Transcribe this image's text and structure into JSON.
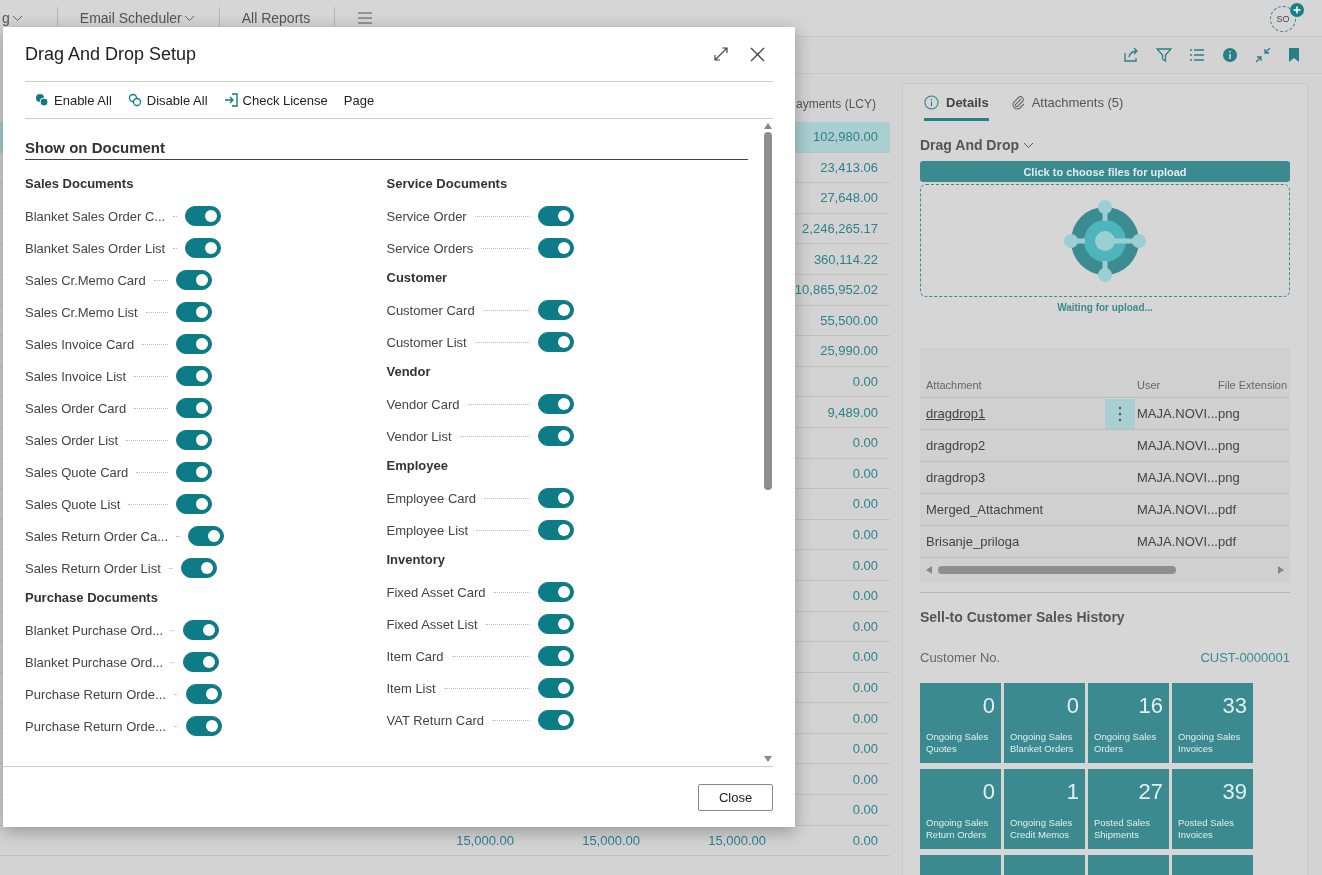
{
  "nav": {
    "items": [
      {
        "label": "g",
        "has_menu": true
      },
      {
        "label": "Email Scheduler",
        "has_menu": true
      },
      {
        "label": "All Reports",
        "has_menu": false
      }
    ]
  },
  "user": {
    "initials": "SO"
  },
  "list": {
    "column": "ayments (LCY)",
    "rows": [
      {
        "value": "102,980.00",
        "selected": true
      },
      {
        "value": "23,413.06",
        "selected": false
      },
      {
        "value": "27,648.00",
        "selected": false
      },
      {
        "value": "2,246,265.17",
        "selected": false
      },
      {
        "value": "360,114.22",
        "selected": false
      },
      {
        "value": "10,865,952.02",
        "selected": false
      },
      {
        "value": "55,500.00",
        "selected": false
      },
      {
        "value": "25,990.00",
        "selected": false
      },
      {
        "value": "0.00",
        "selected": false
      },
      {
        "value": "9,489.00",
        "selected": false
      },
      {
        "value": "0.00",
        "selected": false
      },
      {
        "value": "0.00",
        "selected": false
      },
      {
        "value": "0.00",
        "selected": false
      },
      {
        "value": "0.00",
        "selected": false
      },
      {
        "value": "0.00",
        "selected": false
      },
      {
        "value": "0.00",
        "selected": false
      },
      {
        "value": "0.00",
        "selected": false
      },
      {
        "value": "0.00",
        "selected": false
      },
      {
        "value": "0.00",
        "selected": false
      },
      {
        "value": "0.00",
        "selected": false
      },
      {
        "value": "0.00",
        "selected": false
      },
      {
        "value": "0.00",
        "selected": false
      },
      {
        "value": "0.00",
        "selected": false
      }
    ],
    "bottom_row": [
      "15,000.00",
      "15,000.00",
      "15,000.00",
      "0.00"
    ]
  },
  "dialog": {
    "title": "Drag And Drop Setup",
    "actions": [
      {
        "label": "Enable All",
        "kind": "enable"
      },
      {
        "label": "Disable All",
        "kind": "disable"
      },
      {
        "label": "Check License",
        "kind": "license"
      },
      {
        "label": "Page",
        "kind": "plain"
      }
    ],
    "section": "Show on Document",
    "columns": [
      [
        {
          "title": "Sales Documents",
          "items": [
            {
              "label": "Blanket Sales Order C...",
              "on": true
            },
            {
              "label": "Blanket Sales Order List",
              "on": true
            },
            {
              "label": "Sales Cr.Memo Card",
              "on": true
            },
            {
              "label": "Sales Cr.Memo List",
              "on": true
            },
            {
              "label": "Sales Invoice Card",
              "on": true
            },
            {
              "label": "Sales Invoice List",
              "on": true
            },
            {
              "label": "Sales Order Card",
              "on": true
            },
            {
              "label": "Sales Order List",
              "on": true
            },
            {
              "label": "Sales Quote Card",
              "on": true
            },
            {
              "label": "Sales Quote List",
              "on": true
            },
            {
              "label": "Sales Return Order Ca...",
              "on": true
            },
            {
              "label": "Sales Return Order List",
              "on": true
            }
          ]
        },
        {
          "title": "Purchase Documents",
          "items": [
            {
              "label": "Blanket Purchase Ord...",
              "on": true
            },
            {
              "label": "Blanket Purchase Ord...",
              "on": true
            },
            {
              "label": "Purchase Return Orde...",
              "on": true
            },
            {
              "label": "Purchase Return Orde...",
              "on": true
            }
          ]
        }
      ],
      [
        {
          "title": "Service Documents",
          "items": [
            {
              "label": "Service Order",
              "on": true
            },
            {
              "label": "Service Orders",
              "on": true
            }
          ]
        },
        {
          "title": "Customer",
          "items": [
            {
              "label": "Customer Card",
              "on": true
            },
            {
              "label": "Customer List",
              "on": true
            }
          ]
        },
        {
          "title": "Vendor",
          "items": [
            {
              "label": "Vendor Card",
              "on": true
            },
            {
              "label": "Vendor List",
              "on": true
            }
          ]
        },
        {
          "title": "Employee",
          "items": [
            {
              "label": "Employee Card",
              "on": true
            },
            {
              "label": "Employee List",
              "on": true
            }
          ]
        },
        {
          "title": "Inventory",
          "items": [
            {
              "label": "Fixed Asset Card",
              "on": true
            },
            {
              "label": "Fixed Asset List",
              "on": true
            },
            {
              "label": "Item Card",
              "on": true
            },
            {
              "label": "Item List",
              "on": true
            },
            {
              "label": "VAT Return Card",
              "on": true
            }
          ]
        }
      ]
    ],
    "close": "Close"
  },
  "factbox": {
    "tabs": [
      {
        "label": "Details",
        "kind": "info",
        "selected": true
      },
      {
        "label": "Attachments (5)",
        "kind": "attach",
        "selected": false
      }
    ],
    "dnd_title": "Drag And Drop",
    "upload_button": "Click to choose files for upload",
    "status": "Waiting for upload...",
    "attachments": {
      "columns": [
        "Attachment",
        "User",
        "File Extension"
      ],
      "rows": [
        {
          "name": "dragdrop1",
          "user": "MAJA.NOVI...",
          "ext": "png",
          "selected": true
        },
        {
          "name": "dragdrop2",
          "user": "MAJA.NOVI...",
          "ext": "png",
          "selected": false
        },
        {
          "name": "dragdrop3",
          "user": "MAJA.NOVI...",
          "ext": "png",
          "selected": false
        },
        {
          "name": "Merged_Attachment",
          "user": "MAJA.NOVI...",
          "ext": "pdf",
          "selected": false
        },
        {
          "name": "Brisanje_priloga",
          "user": "MAJA.NOVI...",
          "ext": "pdf",
          "selected": false
        }
      ]
    },
    "history_title": "Sell-to Customer Sales History",
    "customer_label": "Customer No.",
    "customer_value": "CUST-0000001",
    "tiles": [
      {
        "value": "0",
        "label": "Ongoing Sales Quotes"
      },
      {
        "value": "0",
        "label": "Ongoing Sales Blanket Orders"
      },
      {
        "value": "16",
        "label": "Ongoing Sales Orders"
      },
      {
        "value": "33",
        "label": "Ongoing Sales Invoices"
      },
      {
        "value": "0",
        "label": "Ongoing Sales Return Orders"
      },
      {
        "value": "1",
        "label": "Ongoing Sales Credit Memos"
      },
      {
        "value": "27",
        "label": "Posted Sales Shipments"
      },
      {
        "value": "39",
        "label": "Posted Sales Invoices"
      }
    ]
  }
}
